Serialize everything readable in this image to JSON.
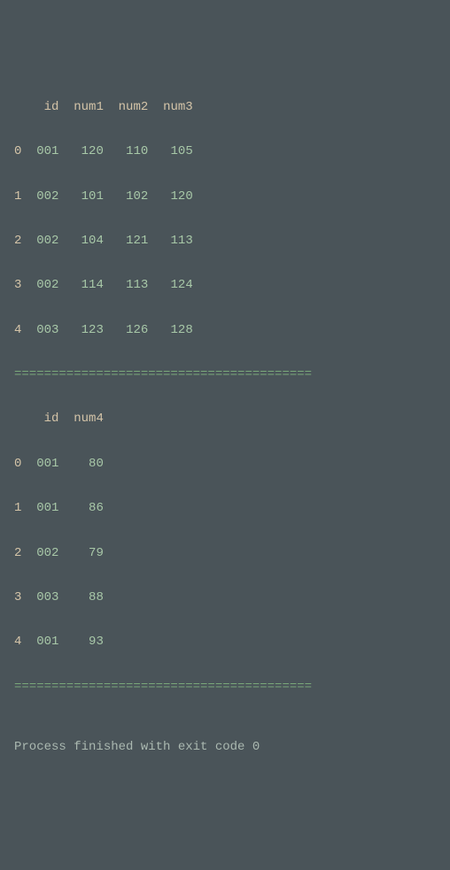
{
  "table1": {
    "columns": [
      "id",
      "num1",
      "num2",
      "num3"
    ],
    "rows": [
      {
        "idx": "0",
        "id": "001",
        "num1": "120",
        "num2": "110",
        "num3": "105"
      },
      {
        "idx": "1",
        "id": "002",
        "num1": "101",
        "num2": "102",
        "num3": "120"
      },
      {
        "idx": "2",
        "id": "002",
        "num1": "104",
        "num2": "121",
        "num3": "113"
      },
      {
        "idx": "3",
        "id": "002",
        "num1": "114",
        "num2": "113",
        "num3": "124"
      },
      {
        "idx": "4",
        "id": "003",
        "num1": "123",
        "num2": "126",
        "num3": "128"
      }
    ]
  },
  "divider": "========================================",
  "table2": {
    "columns": [
      "id",
      "num4"
    ],
    "rows": [
      {
        "idx": "0",
        "id": "001",
        "num4": "80"
      },
      {
        "idx": "1",
        "id": "001",
        "num4": "86"
      },
      {
        "idx": "2",
        "id": "002",
        "num4": "79"
      },
      {
        "idx": "3",
        "id": "003",
        "num4": "88"
      },
      {
        "idx": "4",
        "id": "001",
        "num4": "93"
      }
    ]
  },
  "exit_message": "Process finished with exit code 0"
}
